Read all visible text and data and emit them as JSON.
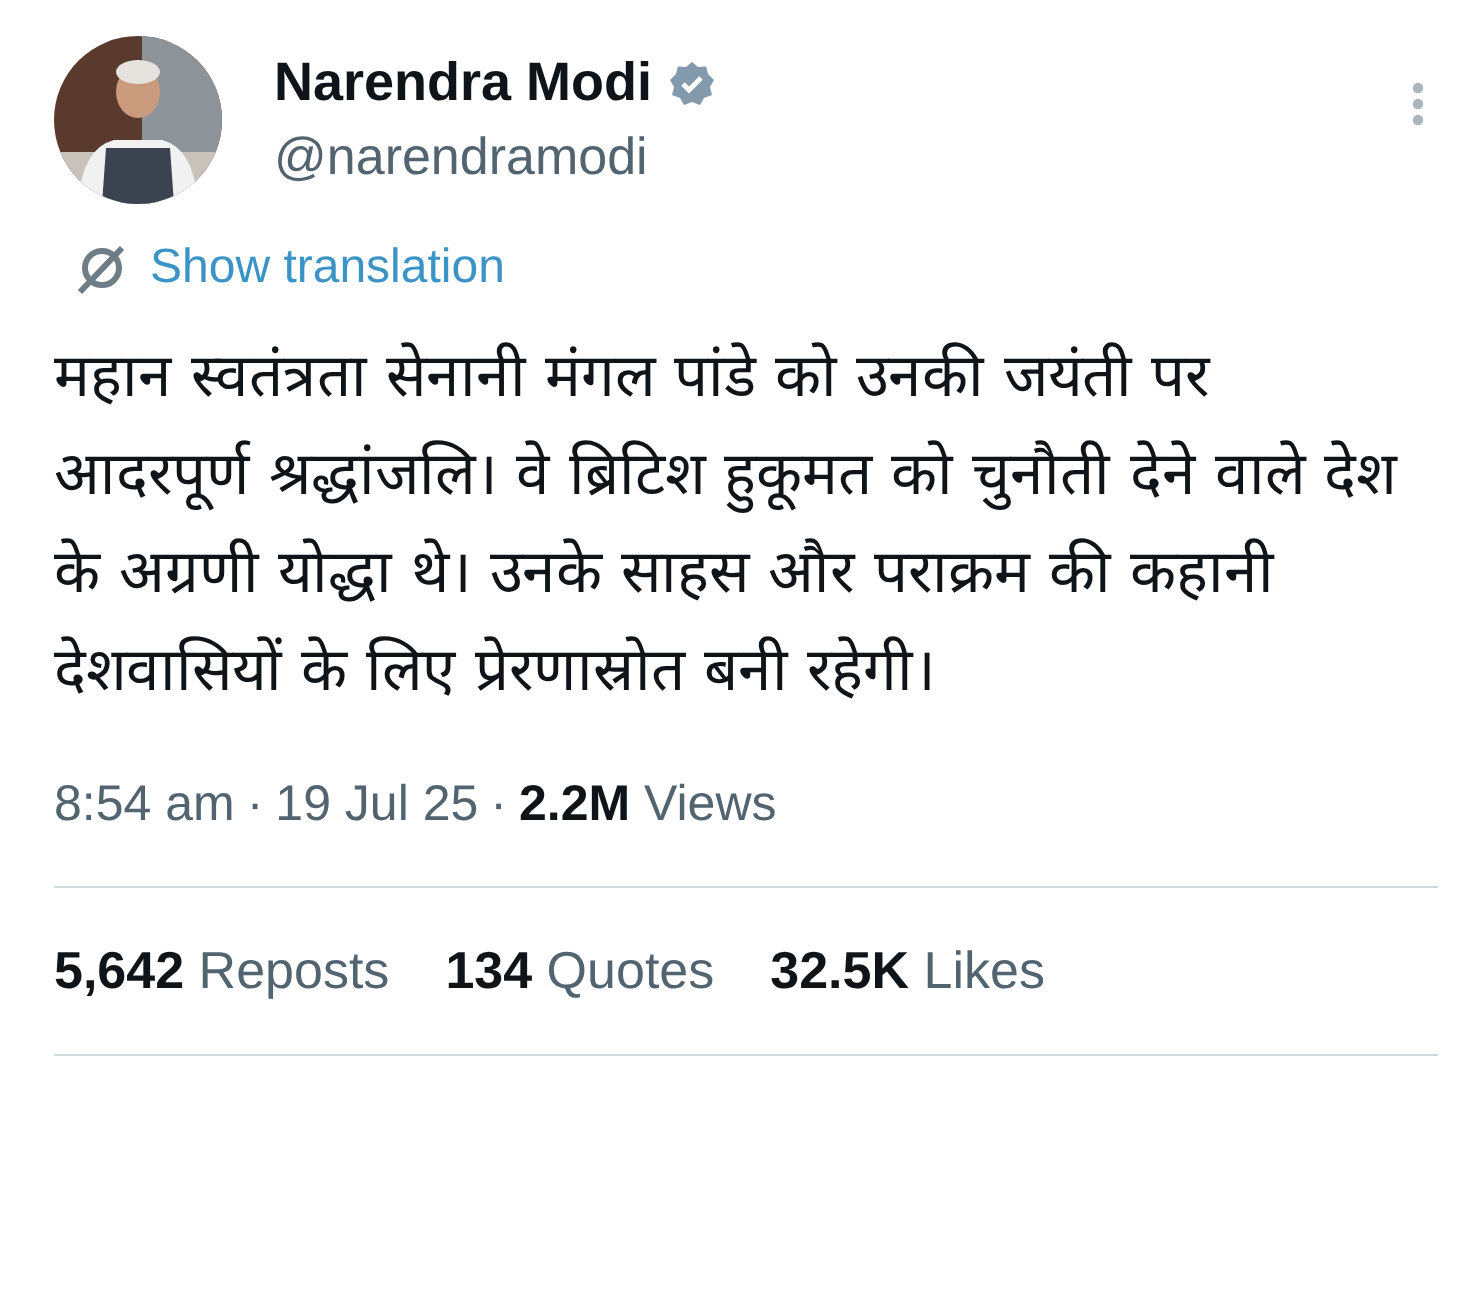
{
  "author": {
    "name": "Narendra Modi",
    "handle": "@narendramodi",
    "verified": true
  },
  "translate_link": "Show translation",
  "text": "महान स्वतंत्रता सेनानी मंगल पांडे को उनकी जयंती पर आदरपूर्ण श्रद्धांजलि। वे ब्रिटिश हुकूमत को चुनौती देने वाले देश के अग्रणी योद्धा थे। उनके साहस और पराक्रम की कहानी देशवासियों के लिए प्रेरणास्रोत बनी रहेगी।",
  "meta": {
    "time": "8:54 am",
    "separator": "·",
    "date": "19 Jul 25",
    "views": "**2.2M** Views"
  },
  "stats": [
    {
      "label": "**5,642** Reposts"
    },
    {
      "label": "**134** Quotes"
    },
    {
      "label": "**32.5K** Likes"
    }
  ]
}
